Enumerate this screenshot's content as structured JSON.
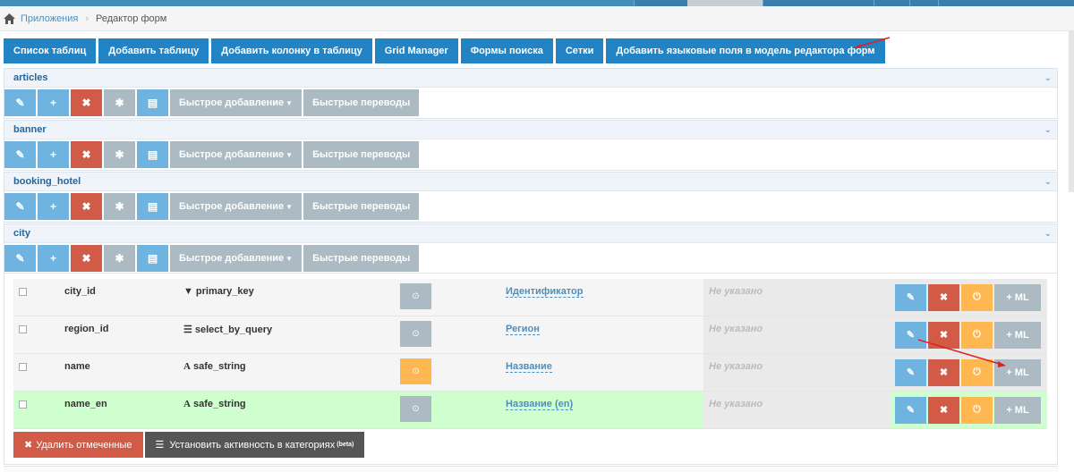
{
  "breadcrumb": {
    "home_icon": "home-icon",
    "parent": "Приложения",
    "current": "Редактор форм"
  },
  "tabs": [
    {
      "label": "Список таблиц"
    },
    {
      "label": "Добавить таблицу"
    },
    {
      "label": "Добавить колонку в таблицу"
    },
    {
      "label": "Grid Manager"
    },
    {
      "label": "Формы поиска"
    },
    {
      "label": "Сетки"
    },
    {
      "label": "Добавить языковые поля в модель редактора форм"
    }
  ],
  "panels": [
    {
      "name": "articles"
    },
    {
      "name": "banner"
    },
    {
      "name": "booking_hotel"
    },
    {
      "name": "city"
    }
  ],
  "toolbar": {
    "quick_add": "Быстрое добавление",
    "quick_translations": "Быстрые переводы"
  },
  "rows": [
    {
      "field": "city_id",
      "type": "primary_key",
      "type_icon": "filter-icon",
      "title": "Идентификатор",
      "note": "Не указано",
      "ml": "ML"
    },
    {
      "field": "region_id",
      "type": "select_by_query",
      "type_icon": "list-icon",
      "title": "Регион",
      "note": "Не указано",
      "ml": "ML"
    },
    {
      "field": "name",
      "type": "safe_string",
      "type_icon": "font-icon",
      "title": "Название",
      "note": "Не указано",
      "ml": "ML"
    },
    {
      "field": "name_en",
      "type": "safe_string",
      "type_icon": "font-icon",
      "title": "Название (en)",
      "note": "Не указано",
      "ml": "ML"
    }
  ],
  "bottom": {
    "delete_checked": "Удалить отмеченные",
    "set_activity": "Установить активность в категориях",
    "beta": "(beta)"
  },
  "colors": {
    "primary": "#2283c5",
    "danger": "#d15b47",
    "warning": "#ffb752",
    "grey": "#abbac3",
    "highlight_row": "#cfffcf",
    "annotation": "#e0201f"
  }
}
